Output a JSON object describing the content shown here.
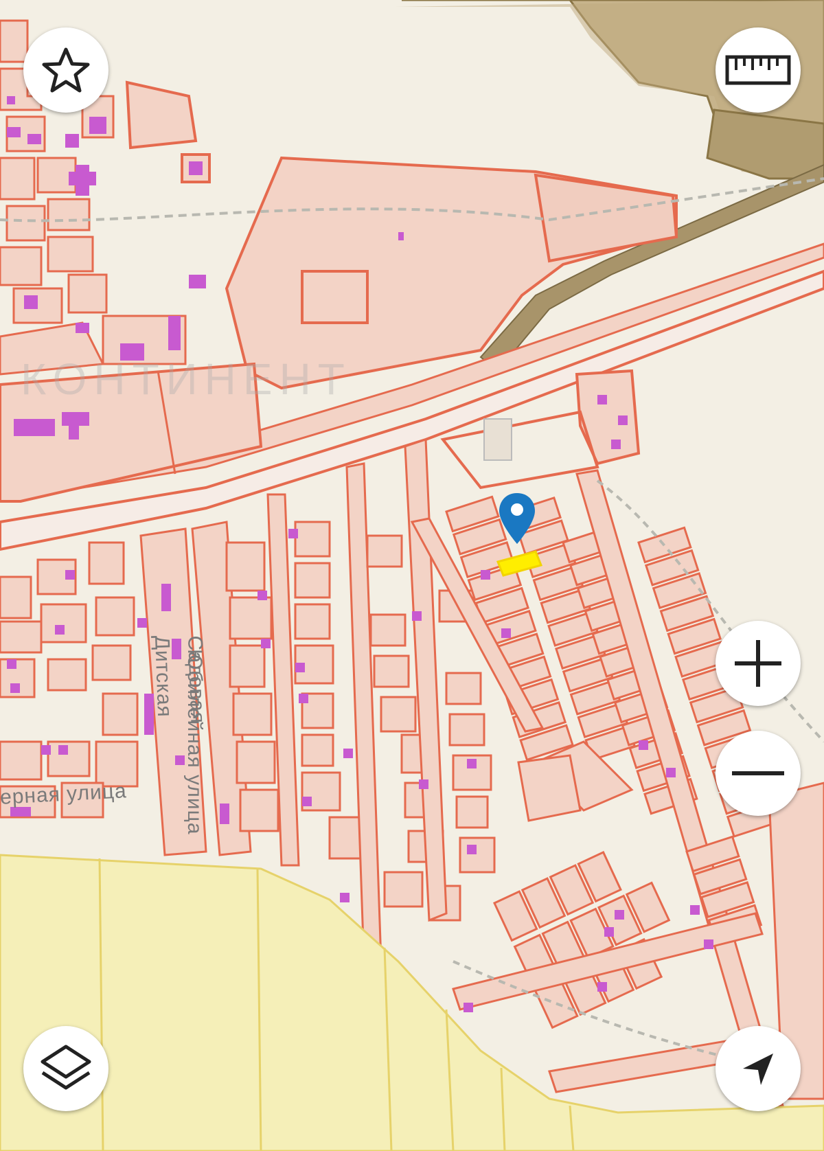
{
  "map": {
    "watermark": "КОНТИНЕНТ",
    "streets": [
      "Юбилейная улица",
      "Садовая",
      "Дитская",
      "ерная улица"
    ],
    "selected_parcel_color": "#ffee00",
    "marker_color": "#1a78c2",
    "parcel_stroke_color": "#e56a4e",
    "parcel_fill_color": "#f3d3c6",
    "building_color": "#c85ad0",
    "farmland_color": "#f5efb8",
    "forest_zone_color": "#c7b48c",
    "road_strip_color": "#a8946a"
  },
  "controls": {
    "favorite": {
      "icon": "star-icon"
    },
    "ruler": {
      "icon": "ruler-icon"
    },
    "zoom_in": {
      "icon": "plus-icon"
    },
    "zoom_out": {
      "icon": "minus-icon"
    },
    "layers": {
      "icon": "layers-icon"
    },
    "locate": {
      "icon": "location-arrow-icon"
    }
  }
}
